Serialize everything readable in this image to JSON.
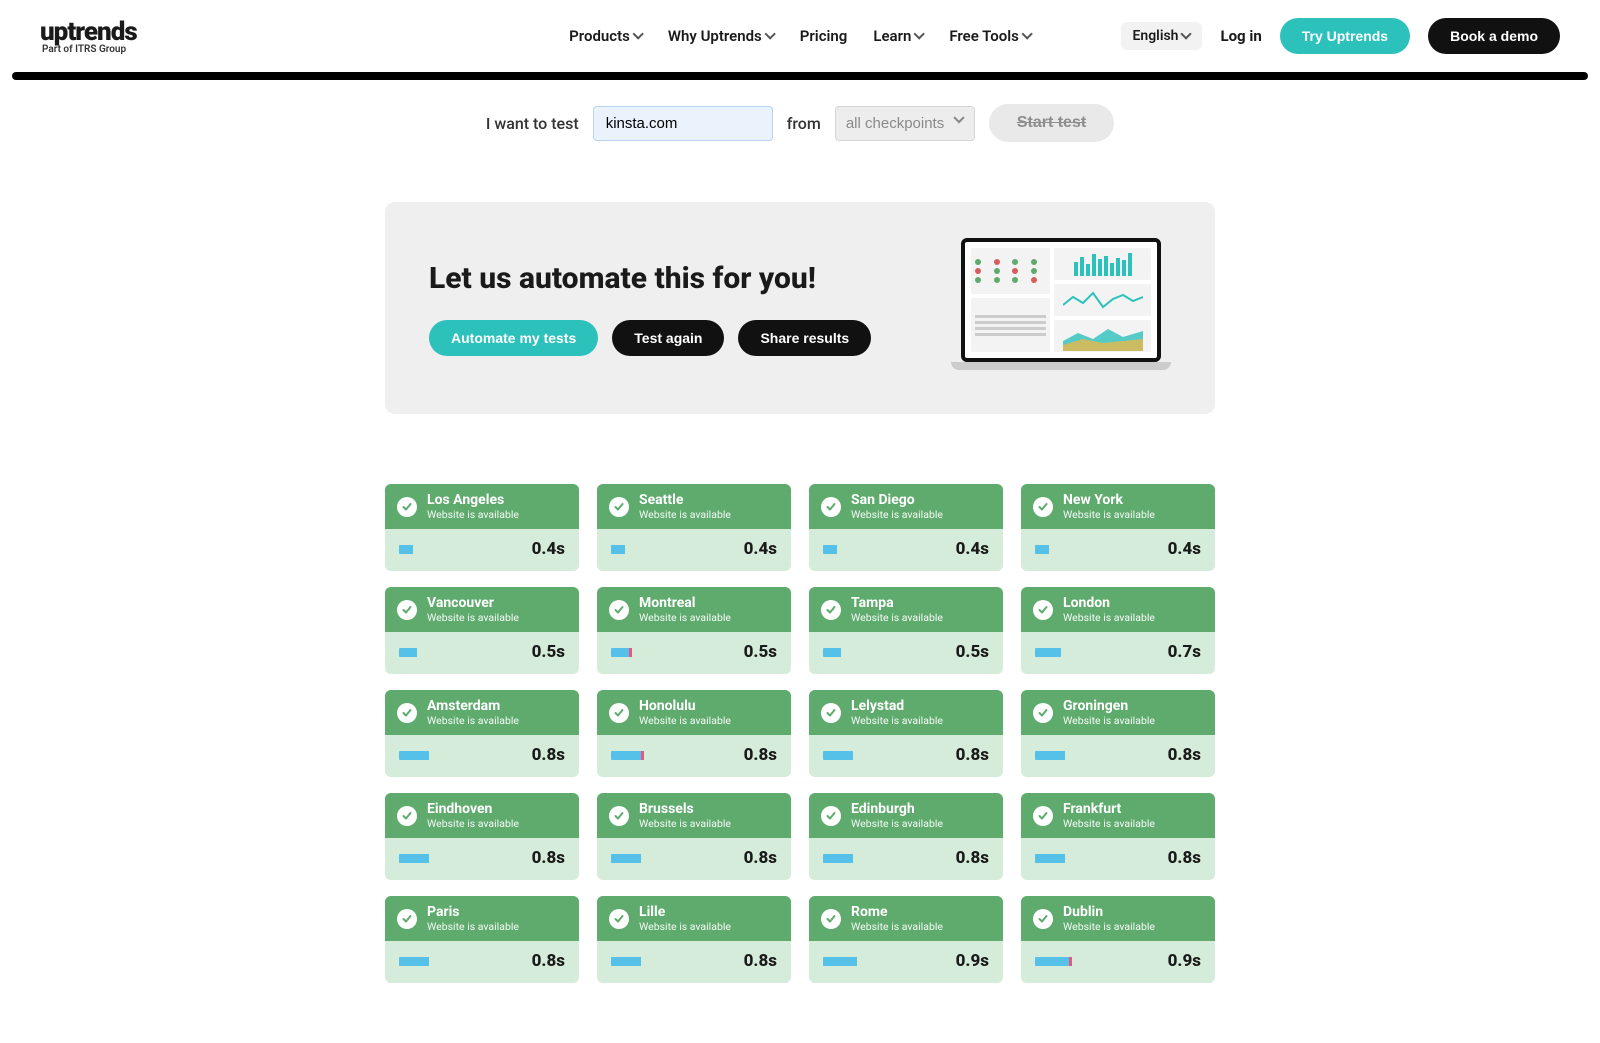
{
  "brand": {
    "name": "uptrends",
    "tagline": "Part of ITRS Group"
  },
  "nav": {
    "products": "Products",
    "why": "Why Uptrends",
    "pricing": "Pricing",
    "learn": "Learn",
    "tools": "Free Tools"
  },
  "right": {
    "language": "English",
    "login": "Log in",
    "try": "Try Uptrends",
    "demo": "Book a demo"
  },
  "tester": {
    "prefix": "I want to test",
    "url_value": "kinsta.com",
    "from": "from",
    "checkpoints_placeholder": "all checkpoints",
    "start": "Start test"
  },
  "promo": {
    "title": "Let us automate this for you!",
    "automate": "Automate my tests",
    "again": "Test again",
    "share": "Share results"
  },
  "status_text": "Website is available",
  "results": [
    {
      "city": "Los Angeles",
      "time": "0.4s",
      "bar": 14,
      "accent": 0
    },
    {
      "city": "Seattle",
      "time": "0.4s",
      "bar": 14,
      "accent": 0
    },
    {
      "city": "San Diego",
      "time": "0.4s",
      "bar": 14,
      "accent": 0
    },
    {
      "city": "New York",
      "time": "0.4s",
      "bar": 14,
      "accent": 0
    },
    {
      "city": "Vancouver",
      "time": "0.5s",
      "bar": 18,
      "accent": 0
    },
    {
      "city": "Montreal",
      "time": "0.5s",
      "bar": 18,
      "accent": 3
    },
    {
      "city": "Tampa",
      "time": "0.5s",
      "bar": 18,
      "accent": 0
    },
    {
      "city": "London",
      "time": "0.7s",
      "bar": 26,
      "accent": 0
    },
    {
      "city": "Amsterdam",
      "time": "0.8s",
      "bar": 30,
      "accent": 0
    },
    {
      "city": "Honolulu",
      "time": "0.8s",
      "bar": 30,
      "accent": 3
    },
    {
      "city": "Lelystad",
      "time": "0.8s",
      "bar": 30,
      "accent": 0
    },
    {
      "city": "Groningen",
      "time": "0.8s",
      "bar": 30,
      "accent": 0
    },
    {
      "city": "Eindhoven",
      "time": "0.8s",
      "bar": 30,
      "accent": 0
    },
    {
      "city": "Brussels",
      "time": "0.8s",
      "bar": 30,
      "accent": 0
    },
    {
      "city": "Edinburgh",
      "time": "0.8s",
      "bar": 30,
      "accent": 0
    },
    {
      "city": "Frankfurt",
      "time": "0.8s",
      "bar": 30,
      "accent": 0
    },
    {
      "city": "Paris",
      "time": "0.8s",
      "bar": 30,
      "accent": 0
    },
    {
      "city": "Lille",
      "time": "0.8s",
      "bar": 30,
      "accent": 0
    },
    {
      "city": "Rome",
      "time": "0.9s",
      "bar": 34,
      "accent": 0
    },
    {
      "city": "Dublin",
      "time": "0.9s",
      "bar": 34,
      "accent": 3
    }
  ]
}
